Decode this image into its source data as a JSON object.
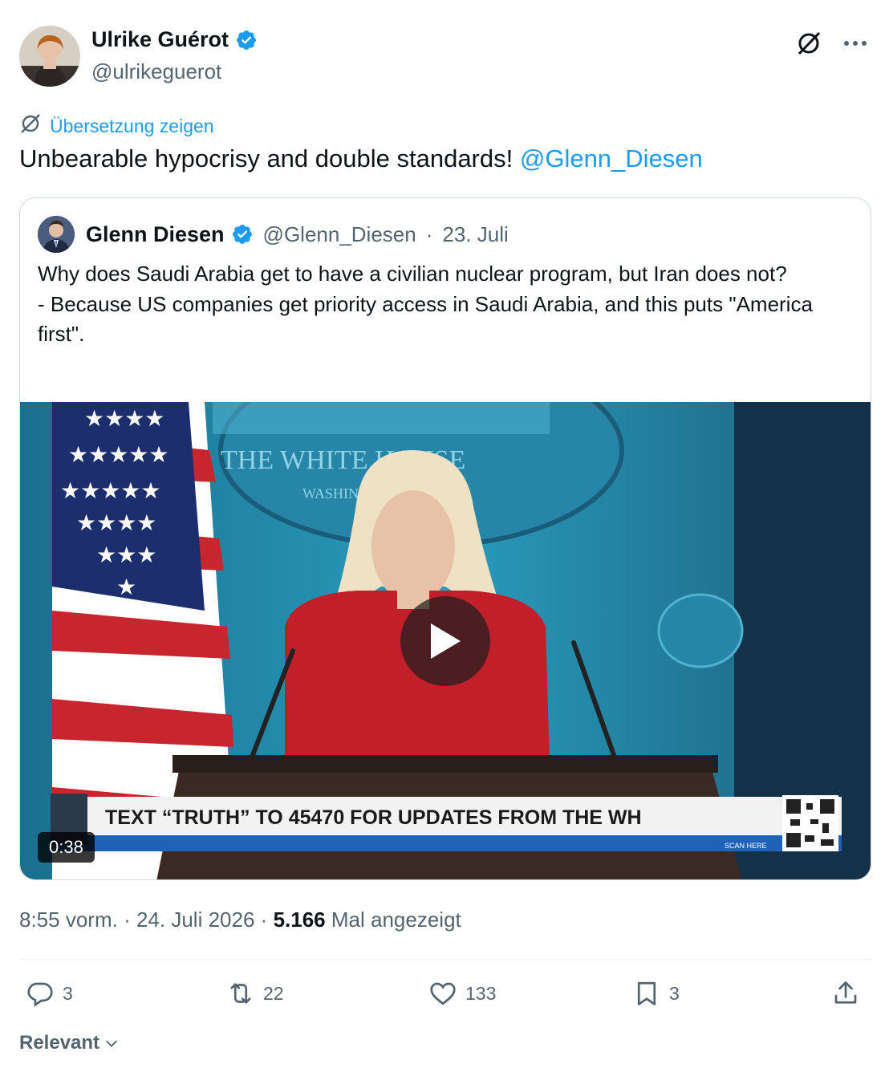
{
  "author": {
    "name": "Ulrike Guérot",
    "handle": "@ulrikeguerot"
  },
  "header_icons": [
    "grok-icon",
    "more-icon"
  ],
  "translate_label": "Übersetzung zeigen",
  "tweet": {
    "text": "Unbearable hypocrisy and double standards! ",
    "mention": "@Glenn_Diesen"
  },
  "quote": {
    "name": "Glenn Diesen",
    "handle": "@Glenn_Diesen",
    "separator": "·",
    "date": "23. Juli",
    "text": "Why does Saudi Arabia get to have a civilian nuclear program, but Iran does not?\n- Because US companies get priority access in Saudi Arabia, and this puts \"America first\".",
    "video": {
      "duration": "0:38",
      "seal_text": "THE WHITE HOUSE",
      "seal_subtext": "WASHINGTON",
      "banner_text": "TEXT “TRUTH” TO 45470 FOR UPDATES FROM THE WH",
      "scan_label": "SCAN HERE"
    }
  },
  "meta": {
    "time": "8:55 vorm.",
    "separator": "·",
    "date": "24. Juli 2026",
    "views_count": "5.166",
    "views_label": "Mal angezeigt"
  },
  "actions": {
    "replies": "3",
    "reposts": "22",
    "likes": "133",
    "bookmarks": "3"
  },
  "sort_label": "Relevant",
  "colors": {
    "accent": "#1d9bf0",
    "text": "#0f1419",
    "muted": "#536471",
    "border": "#cfd9de"
  }
}
